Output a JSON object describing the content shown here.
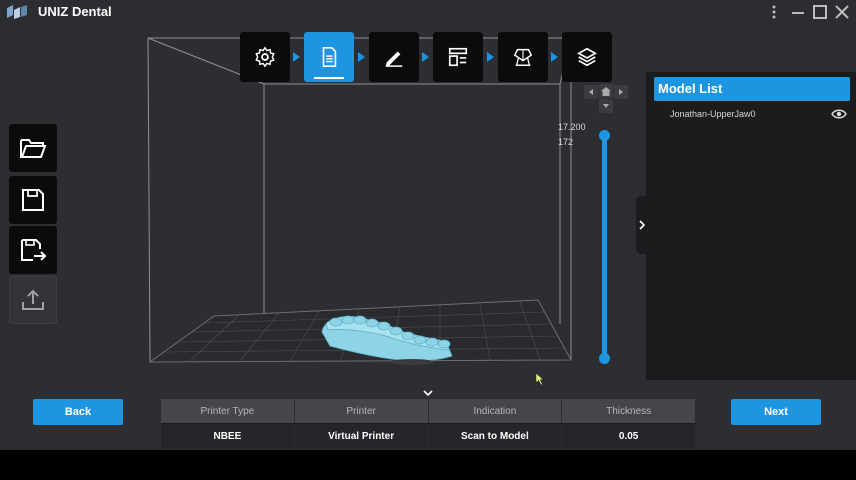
{
  "app": {
    "title": "UNIZ Dental",
    "accent_color": "#1d95e0"
  },
  "window_controls": [
    {
      "name": "more-options-icon"
    },
    {
      "name": "minimize-icon"
    },
    {
      "name": "maximize-icon"
    },
    {
      "name": "close-icon"
    }
  ],
  "workflow_steps": [
    {
      "name": "settings",
      "icon": "gear-icon",
      "active": false
    },
    {
      "name": "document",
      "icon": "document-icon",
      "active": true
    },
    {
      "name": "edit",
      "icon": "pen-icon",
      "active": false
    },
    {
      "name": "layout",
      "icon": "layout-icon",
      "active": false
    },
    {
      "name": "support",
      "icon": "support-icon",
      "active": false
    },
    {
      "name": "slice",
      "icon": "layers-icon",
      "active": false
    }
  ],
  "side_tools": [
    {
      "name": "open",
      "icon": "folder-open-icon",
      "enabled": true
    },
    {
      "name": "save",
      "icon": "save-icon",
      "enabled": true
    },
    {
      "name": "save-as",
      "icon": "save-as-icon",
      "enabled": true
    },
    {
      "name": "export",
      "icon": "upload-icon",
      "enabled": false
    }
  ],
  "model_panel": {
    "title": "Model List",
    "models": [
      {
        "name": "Jonathan-UpperJaw0",
        "visible": true
      }
    ]
  },
  "layer_slider": {
    "top_value": "17.200",
    "current_layer": "172"
  },
  "buttons": {
    "back": "Back",
    "next": "Next"
  },
  "info_table": {
    "headers": [
      "Printer Type",
      "Printer",
      "Indication",
      "Thickness"
    ],
    "values": [
      "NBEE",
      "Virtual Printer",
      "Scan to Model",
      "0.05"
    ]
  }
}
